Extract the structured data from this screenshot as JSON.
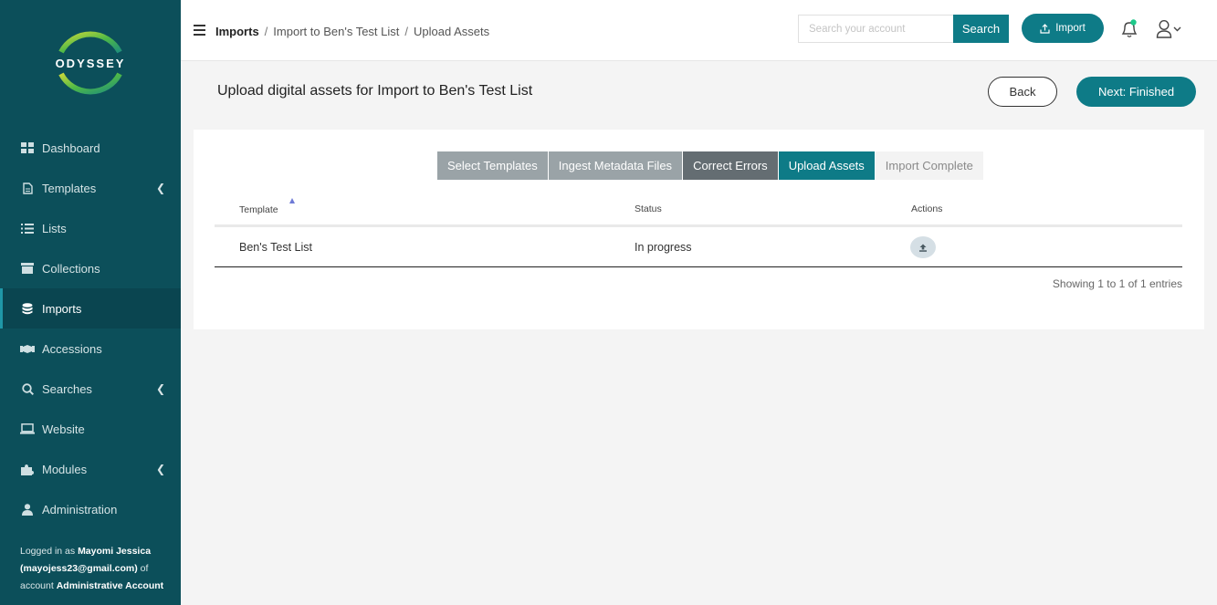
{
  "sidebar": {
    "logo": "ODYSSEY",
    "items": [
      {
        "label": "Dashboard"
      },
      {
        "label": "Templates"
      },
      {
        "label": "Lists"
      },
      {
        "label": "Collections"
      },
      {
        "label": "Imports"
      },
      {
        "label": "Accessions"
      },
      {
        "label": "Searches"
      },
      {
        "label": "Website"
      },
      {
        "label": "Modules"
      },
      {
        "label": "Administration"
      }
    ],
    "login": {
      "prefix": "Logged in as ",
      "name": "Mayomi Jessica",
      "email": "(mayojess23@gmail.com)",
      "of_account": " of account ",
      "account": "Administrative Account"
    }
  },
  "header": {
    "breadcrumb": [
      "Imports",
      "Import to Ben's Test List",
      "Upload Assets"
    ],
    "search_placeholder": "Search your account",
    "search_label": "Search",
    "import_label": "Import"
  },
  "page": {
    "title": "Upload digital assets for Import to Ben's Test List",
    "back_label": "Back",
    "next_label": "Next: Finished"
  },
  "steps": [
    {
      "label": "Select Templates"
    },
    {
      "label": "Ingest Metadata Files"
    },
    {
      "label": "Correct Errors"
    },
    {
      "label": "Upload Assets"
    },
    {
      "label": "Import Complete"
    }
  ],
  "table": {
    "columns": [
      "Template",
      "Status",
      "Actions"
    ],
    "rows": [
      {
        "template": "Ben's Test List",
        "status": "In progress"
      }
    ],
    "info": "Showing 1 to 1 of 1 entries"
  },
  "colors": {
    "sidebar": "#0c4f5a",
    "accent": "#0e7b87"
  }
}
